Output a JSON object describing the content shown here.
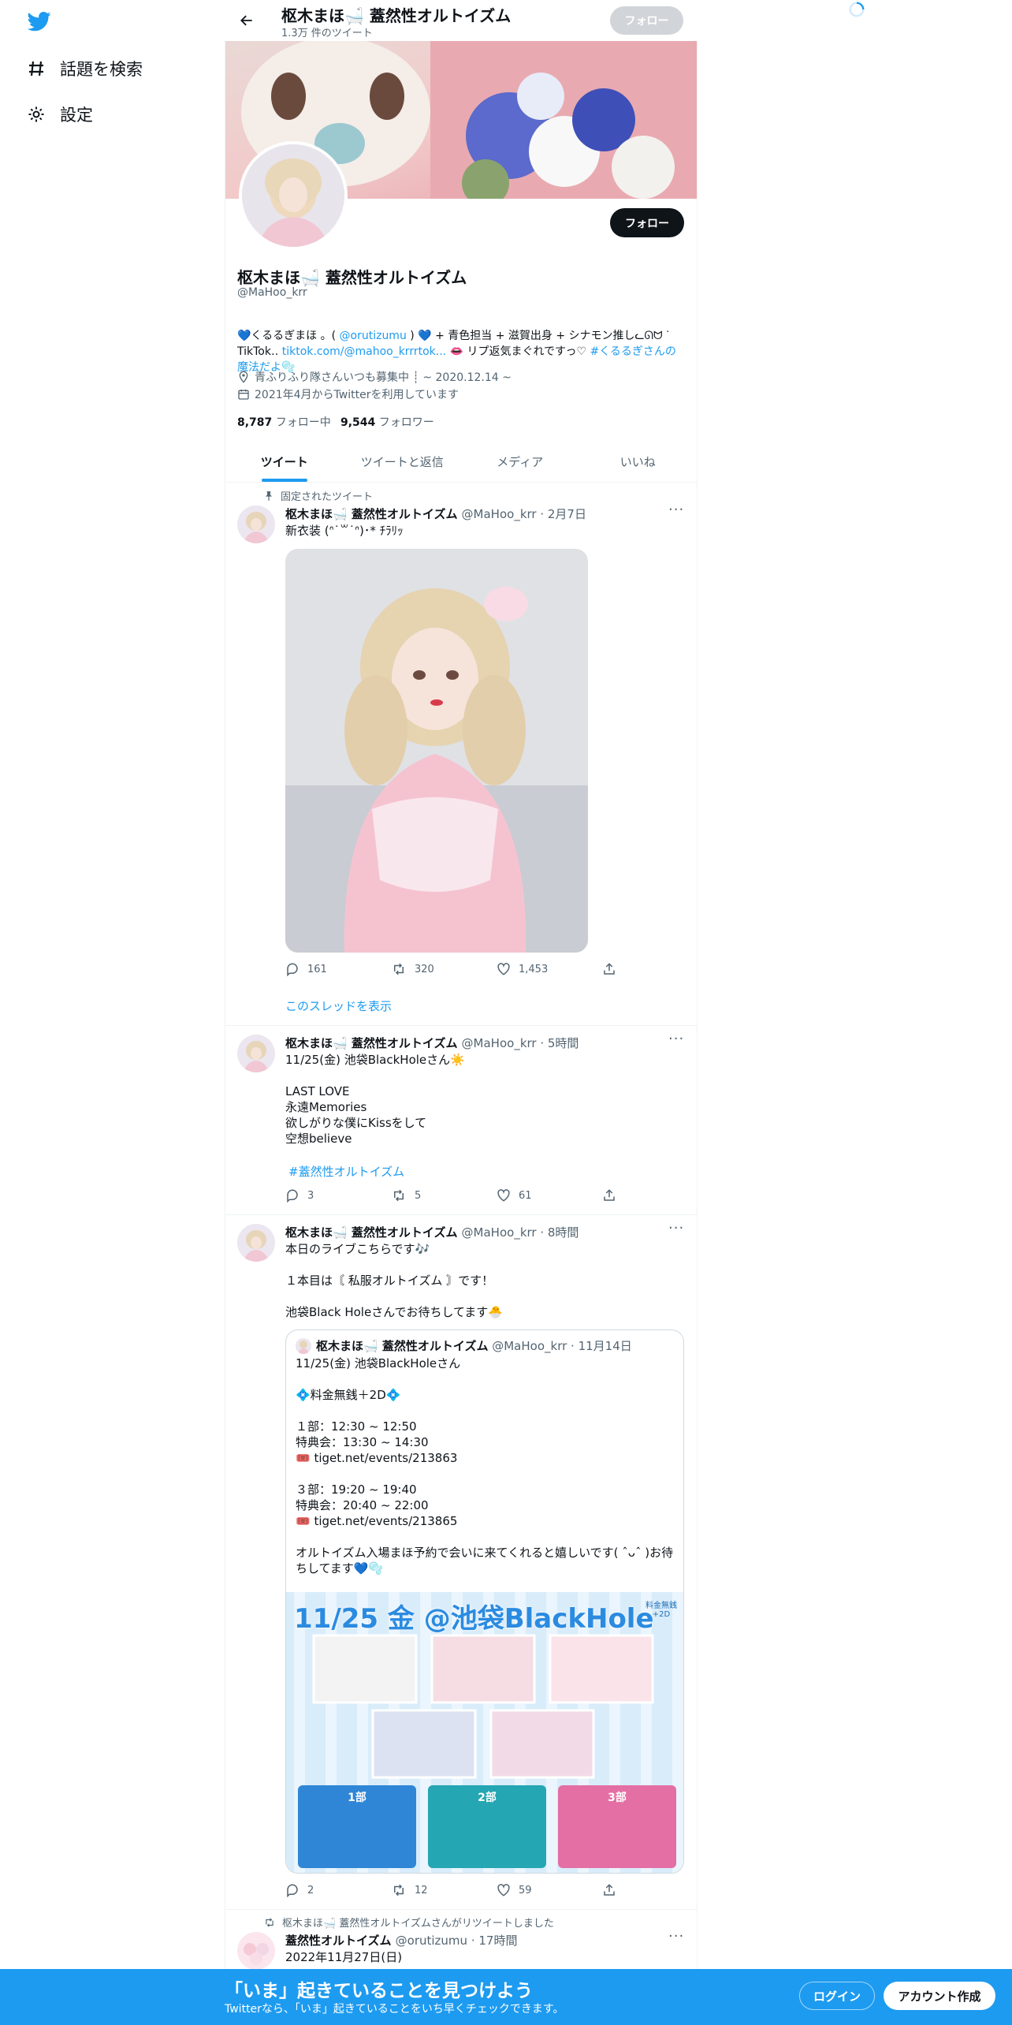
{
  "nav": {
    "items": [
      {
        "label": "話題を検索",
        "icon": "hashtag-icon"
      },
      {
        "label": "設定",
        "icon": "gear-icon"
      }
    ]
  },
  "header": {
    "title": "枢木まほ🛁 蓋然性オルトイズム",
    "subtitle": "1.3万 件のツイート",
    "follow_label": "フォロー"
  },
  "profile": {
    "name": "枢木まほ🛁 蓋然性オルトイズム",
    "handle": "@MaHoo_krr",
    "follow_label": "フォロー",
    "bio_1": "💙くるるぎまほ 。( ",
    "bio_mention": "@orutizumu",
    "bio_2": " ) 💙 + 青色担当 + 滋賀出身 + シナモン推しᓚᘏᗢ ᐝ TikTok‥ ",
    "bio_link": "tiktok.com/@mahoo_krrrtok...",
    "bio_3": " 👄 リプ返気まぐれですっ♡ ",
    "bio_hashtag": "#くるるぎさんの魔法だよ🫧",
    "location": "青ふりふり隊さんいつも募集中 ┊ ~ 2020.12.14 ~",
    "joined": "2021年4月からTwitterを利用しています",
    "following_count": "8,787",
    "following_label": "フォロー中",
    "followers_count": "9,544",
    "followers_label": "フォロワー"
  },
  "tabs": [
    {
      "label": "ツイート"
    },
    {
      "label": "ツイートと返信"
    },
    {
      "label": "メディア"
    },
    {
      "label": "いいね"
    }
  ],
  "tweets": [
    {
      "context": "固定されたツイート",
      "name": "枢木まほ🛁 蓋然性オルトイズム",
      "meta": "@MaHoo_krr · 2月7日",
      "text": "新衣装 (ᐢ˙꒳˙ᐢ)･* ﾁﾗﾘｯ",
      "replies": "161",
      "retweets": "320",
      "likes": "1,453",
      "thread_link": "このスレッドを表示"
    },
    {
      "name": "枢木まほ🛁 蓋然性オルトイズム",
      "meta": "@MaHoo_krr · 5時間",
      "text": "11/25(金) 池袋BlackHoleさん☀️\n\nLAST LOVE\n永遠Memories\n欲しがりな僕にKissをして\n空想believe",
      "hashtag": "#蓋然性オルトイズム",
      "replies": "3",
      "retweets": "5",
      "likes": "61"
    },
    {
      "name": "枢木まほ🛁 蓋然性オルトイズム",
      "meta": "@MaHoo_krr · 8時間",
      "text": "本日のライブこちらです🎶\n\n１本目は〘 私服オルトイズム 〙です！\n\n池袋Black Holeさんでお待ちしてます🐣",
      "replies": "2",
      "retweets": "12",
      "likes": "59",
      "quote": {
        "name": "枢木まほ🛁 蓋然性オルトイズム",
        "meta": "@MaHoo_krr · 11月14日",
        "text": "11/25(金) 池袋BlackHoleさん\n\n💠料金無銭＋2D💠\n\n１部：12:30 ~ 12:50\n特典会：13:30 ~ 14:30\n🎟️ tiget.net/events/213863\n\n３部：19:20 ~ 19:40\n特典会：20:40 ~ 22:00\n🎟️ tiget.net/events/213865\n\nオルトイズム入場まほ予約で会いに来てくれると嬉しいです( ˆᴗˆ )お待ちしてます💙🫧",
        "flyer_title": "11/25 金 @池袋BlackHole",
        "flyer_note": "料金無銭 +2D",
        "flyer_parts": [
          "1部",
          "2部",
          "3部"
        ]
      }
    },
    {
      "context": "枢木まほ🛁 蓋然性オルトイズムさんがリツイートしました",
      "name": "蓋然性オルトイズム",
      "meta": "@orutizumu · 17時間",
      "text": "2022年11月27日(日)"
    }
  ],
  "bottom_bar": {
    "headline": "「いま」起きていることを見つけよう",
    "sub": "Twitterなら、「いま」起きていることをいち早くチェックできます。",
    "login_label": "ログイン",
    "signup_label": "アカウント作成"
  },
  "colors": {
    "accent": "#1d9bf0",
    "text": "#0f1419",
    "muted": "#536471"
  }
}
